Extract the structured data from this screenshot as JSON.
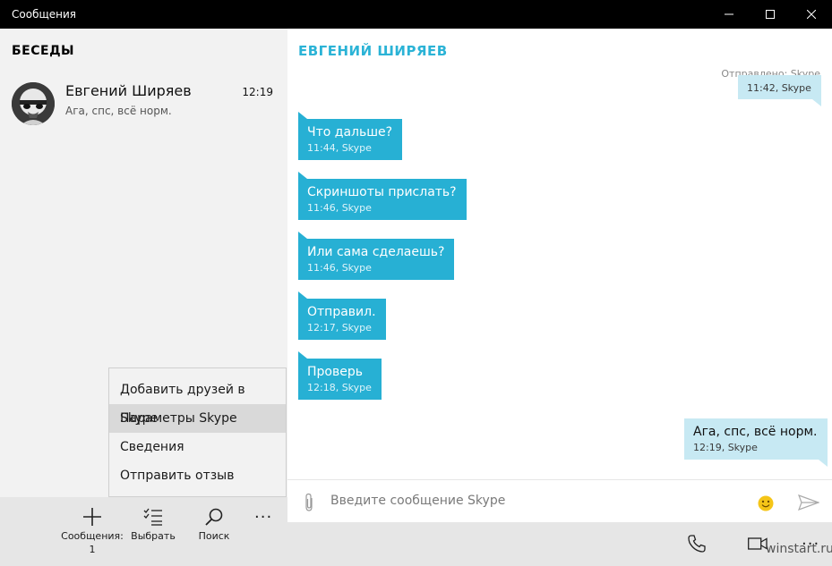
{
  "window": {
    "title": "Сообщения",
    "controls": [
      "minimize-icon",
      "maximize-icon",
      "close-icon"
    ]
  },
  "sidebar": {
    "heading": "БЕСЕДЫ",
    "conversations": [
      {
        "name": "Евгений Ширяев",
        "time": "12:19",
        "preview": "Ага, спс, всё норм."
      }
    ]
  },
  "context_menu": {
    "items": [
      {
        "label": "Добавить друзей в Skype",
        "active": false
      },
      {
        "label": "Параметры Skype",
        "active": true
      },
      {
        "label": "Сведения",
        "active": false
      },
      {
        "label": "Отправить отзыв",
        "active": false
      }
    ]
  },
  "app_bar_left": {
    "new_message": {
      "label": "Сообщения:",
      "count": "1",
      "icon": "plus-icon"
    },
    "select": {
      "label": "Выбрать",
      "icon": "select-list-icon"
    },
    "search": {
      "label": "Поиск",
      "icon": "search-icon"
    },
    "more": "···"
  },
  "chat": {
    "contact_name": "ЕВГЕНИЙ ШИРЯЕВ",
    "sent_via": "Отправлено: Skype",
    "messages": [
      {
        "direction": "out",
        "text": "",
        "meta": "11:42, Skype"
      },
      {
        "direction": "in",
        "text": "Что дальше?",
        "meta": "11:44, Skype"
      },
      {
        "direction": "in",
        "text": "Скриншоты прислать?",
        "meta": "11:46, Skype"
      },
      {
        "direction": "in",
        "text": "Или сама сделаешь?",
        "meta": "11:46, Skype"
      },
      {
        "direction": "in",
        "text": "Отправил.",
        "meta": "12:17, Skype"
      },
      {
        "direction": "in",
        "text": "Проверь",
        "meta": "12:18, Skype"
      },
      {
        "direction": "out",
        "text": "Ага, спс, всё норм.",
        "meta": "12:19, Skype"
      }
    ],
    "composer": {
      "placeholder": "Введите сообщение Skype",
      "icons": [
        "attach-icon",
        "emoji-icon",
        "send-icon"
      ]
    },
    "app_bar": {
      "icons": [
        "phone-icon",
        "video-call-icon"
      ],
      "watermark": "winstart.ru",
      "more": "···"
    }
  },
  "colors": {
    "accent": "#2bb3d6",
    "incoming_bubble": "#27b0d4",
    "outgoing_bubble": "#c7e9f3",
    "sidebar_bg": "#f2f2f2",
    "appbar_bg": "#e6e6e6",
    "titlebar_bg": "#000000",
    "emoji": "#f5c518"
  }
}
